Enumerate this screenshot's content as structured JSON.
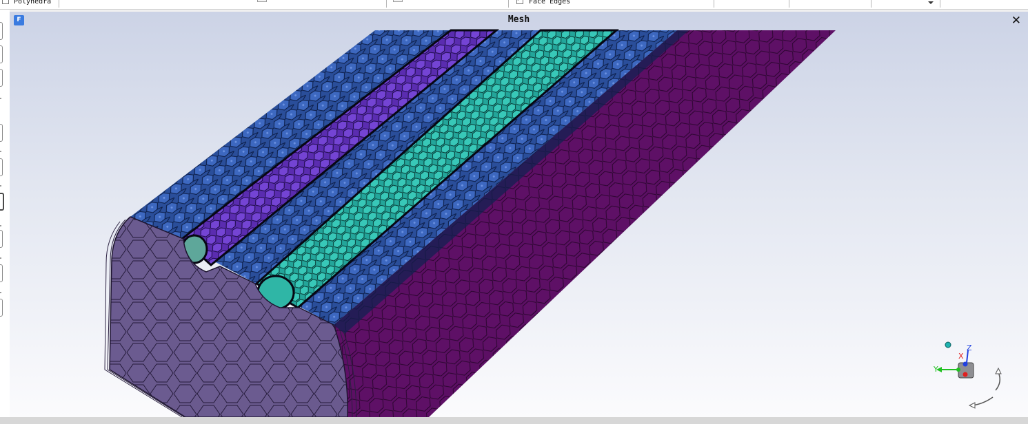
{
  "toolbar": {
    "items": [
      {
        "label": "Polyhedra",
        "checked": false
      },
      {
        "label": "Face Edges",
        "checked": true
      }
    ]
  },
  "graphics_window": {
    "title": "Mesh",
    "icon": "fluent-app-icon",
    "icon_letter": "F",
    "close_glyph": "✕"
  },
  "triad": {
    "x_label": "X",
    "y_label": "Y",
    "z_label": "Z",
    "colors": {
      "x": "#e02020",
      "y": "#20c020",
      "z": "#2040e0"
    }
  },
  "colors": {
    "background_top": "#ccd3e6",
    "background_bottom": "#fbfbfd",
    "end_face": "#6a5a8e",
    "side_face": "#5c0f64",
    "top_surface": "#2a4e9a",
    "groove_purple": "#6a38c8",
    "groove_teal": "#2fb6a6"
  }
}
